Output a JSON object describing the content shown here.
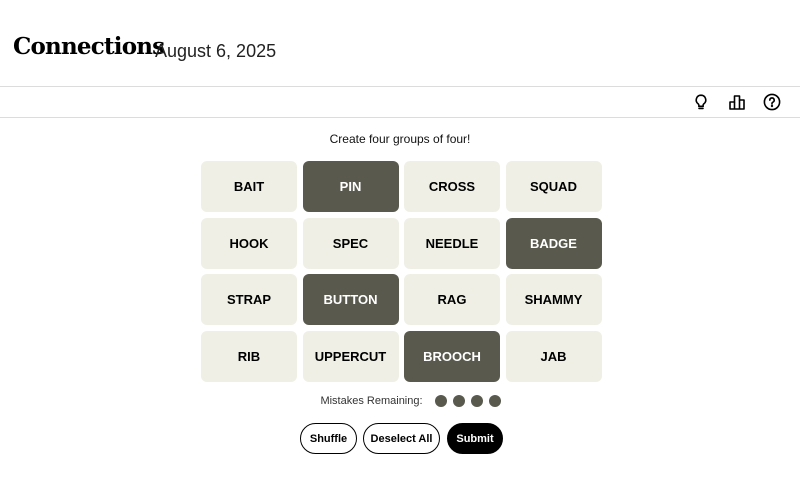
{
  "header": {
    "title": "Connections",
    "date": "August 6, 2025"
  },
  "toolbar": {
    "icons": [
      "lightbulb-icon",
      "leaderboard-icon",
      "help-icon"
    ]
  },
  "game": {
    "instructions": "Create four groups of four!",
    "tiles": [
      {
        "label": "BAIT",
        "selected": false
      },
      {
        "label": "PIN",
        "selected": true
      },
      {
        "label": "CROSS",
        "selected": false
      },
      {
        "label": "SQUAD",
        "selected": false
      },
      {
        "label": "HOOK",
        "selected": false
      },
      {
        "label": "SPEC",
        "selected": false
      },
      {
        "label": "NEEDLE",
        "selected": false
      },
      {
        "label": "BADGE",
        "selected": true
      },
      {
        "label": "STRAP",
        "selected": false
      },
      {
        "label": "BUTTON",
        "selected": true
      },
      {
        "label": "RAG",
        "selected": false
      },
      {
        "label": "SHAMMY",
        "selected": false
      },
      {
        "label": "RIB",
        "selected": false
      },
      {
        "label": "UPPERCUT",
        "selected": false
      },
      {
        "label": "BROOCH",
        "selected": true
      },
      {
        "label": "JAB",
        "selected": false
      }
    ],
    "mistakes_label": "Mistakes Remaining:",
    "mistakes_remaining": 4
  },
  "actions": {
    "shuffle": "Shuffle",
    "deselect_all": "Deselect All",
    "submit": "Submit"
  },
  "colors": {
    "tile_background": "#efefe6",
    "tile_selected": "#5a594e",
    "dot": "#5a594e"
  }
}
